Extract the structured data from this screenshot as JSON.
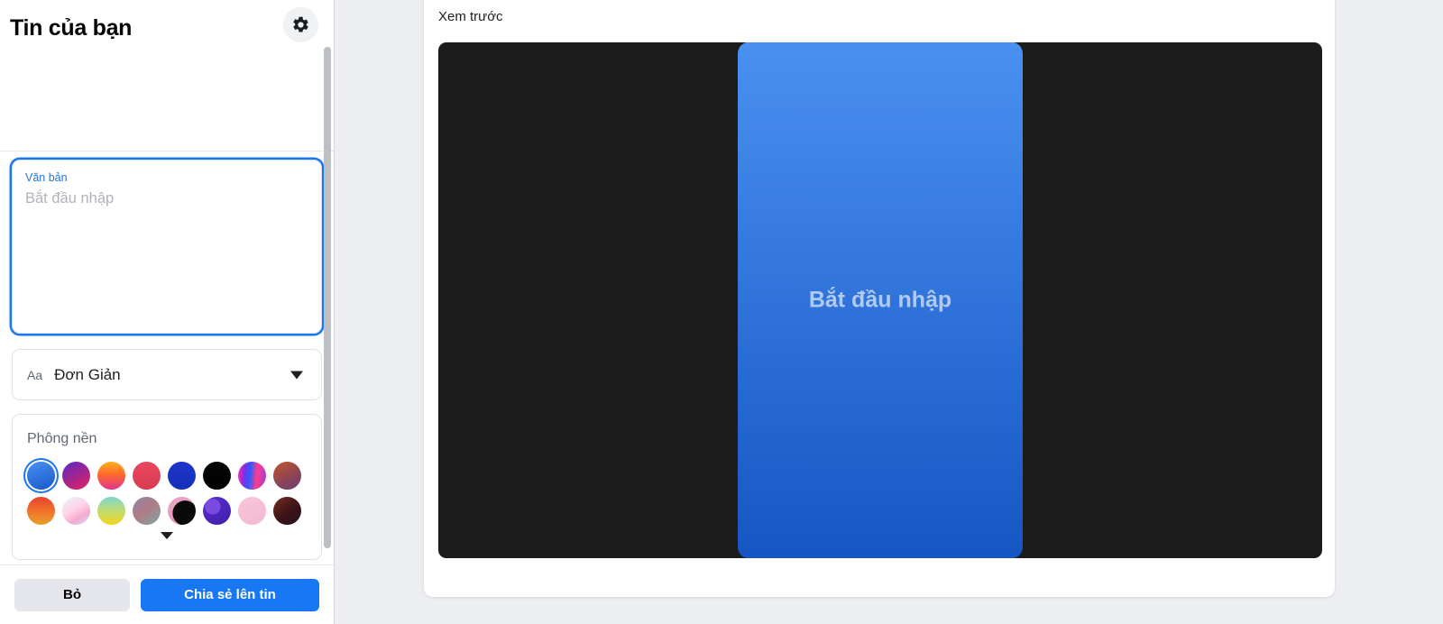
{
  "colors": {
    "accent": "#1877f2",
    "accent_link": "#1b74e4",
    "page_bg": "#eceef2",
    "panel_bg": "#ffffff",
    "canvas_bg": "#1c1c1d",
    "secondary_btn": "#e4e6eb",
    "text_primary": "#050505",
    "text_secondary": "#606770",
    "placeholder": "#b0b3b8",
    "story_top": "#4a90f0",
    "story_bottom": "#1656c4"
  },
  "sidebar": {
    "title": "Tin của bạn",
    "settings_icon": "gear-icon",
    "text_field": {
      "label": "Văn bản",
      "placeholder": "Bắt đầu nhập",
      "value": ""
    },
    "font_select": {
      "icon_label": "Aa",
      "selected": "Đơn Giản",
      "caret_icon": "chevron-down-icon"
    },
    "background": {
      "label": "Phông nền",
      "expand_icon": "chevron-down-icon",
      "swatches": [
        {
          "name": "blue-gradient",
          "selected": true,
          "css": "linear-gradient(160deg,#4a90f0 0%,#1758cc 100%)"
        },
        {
          "name": "purple-magenta",
          "selected": false,
          "css": "linear-gradient(150deg,#5b2bc9 0%,#a0258f 50%,#e8245a 100%)"
        },
        {
          "name": "orange-pink",
          "selected": false,
          "css": "linear-gradient(180deg,#ffb11f 0%,#ff6a2a 45%,#e0348f 100%)"
        },
        {
          "name": "coral-red",
          "selected": false,
          "css": "linear-gradient(180deg,#e8485e 0%,#d93b53 100%)"
        },
        {
          "name": "royal-blue",
          "selected": false,
          "css": "linear-gradient(180deg,#1f36c9 0%,#1330b8 100%)"
        },
        {
          "name": "black",
          "selected": false,
          "css": "linear-gradient(180deg,#060606 0%,#000000 100%)"
        },
        {
          "name": "rainbow-swirl",
          "selected": false,
          "css": "linear-gradient(95deg,#ff2fb0 0%,#8a2be2 22%,#2b5bff 42%,#ff3d8b 66%,#9b3ce0 100%)"
        },
        {
          "name": "brown-plum",
          "selected": false,
          "css": "linear-gradient(150deg,#c4562a 0%,#8e4452 55%,#6b3a78 100%)"
        },
        {
          "name": "red-orange",
          "selected": false,
          "css": "linear-gradient(180deg,#e8432e 0%,#ef7b2a 60%,#e6a02b 100%)"
        },
        {
          "name": "pastel-pink-blue",
          "selected": false,
          "css": "linear-gradient(150deg,#eaf3fb 0%,#ffd2e6 45%,#f5a9cf 70%,#cfe3fa 100%)"
        },
        {
          "name": "teal-yellow",
          "selected": false,
          "css": "linear-gradient(180deg,#7ed6cf 0%,#b9dc7a 45%,#f3d417 100%)"
        },
        {
          "name": "muted-mauve-teal",
          "selected": false,
          "css": "linear-gradient(140deg,#8d8aa8 0%,#b07b86 45%,#7aa5a0 100%)"
        },
        {
          "name": "pink-black-blob",
          "selected": false,
          "css": "radial-gradient(circle at 62% 58%,#0a0a0a 0 52%,rgba(0,0,0,0) 53%),linear-gradient(150deg,#f0a7c8 0%,#d98ab4 100%)"
        },
        {
          "name": "purple-texture",
          "selected": false,
          "css": "radial-gradient(circle at 35% 35%,#7b4ae0 0 30%,rgba(0,0,0,0) 31%),linear-gradient(150deg,#5b2fd0 0%,#3f1ea8 100%)"
        },
        {
          "name": "pink-leaves",
          "selected": false,
          "css": "linear-gradient(150deg,#f7c6da 0%,#f3b9d2 100%)"
        },
        {
          "name": "dark-brown-yellow",
          "selected": false,
          "css": "linear-gradient(140deg,#7a2a22 0%,#3a1418 55%,#2a1020 100%)"
        }
      ]
    },
    "footer": {
      "discard_label": "Bỏ",
      "share_label": "Chia sẻ lên tin"
    }
  },
  "preview": {
    "title": "Xem trước",
    "story": {
      "text": "Bắt đầu nhập",
      "background": "blue-gradient"
    }
  }
}
